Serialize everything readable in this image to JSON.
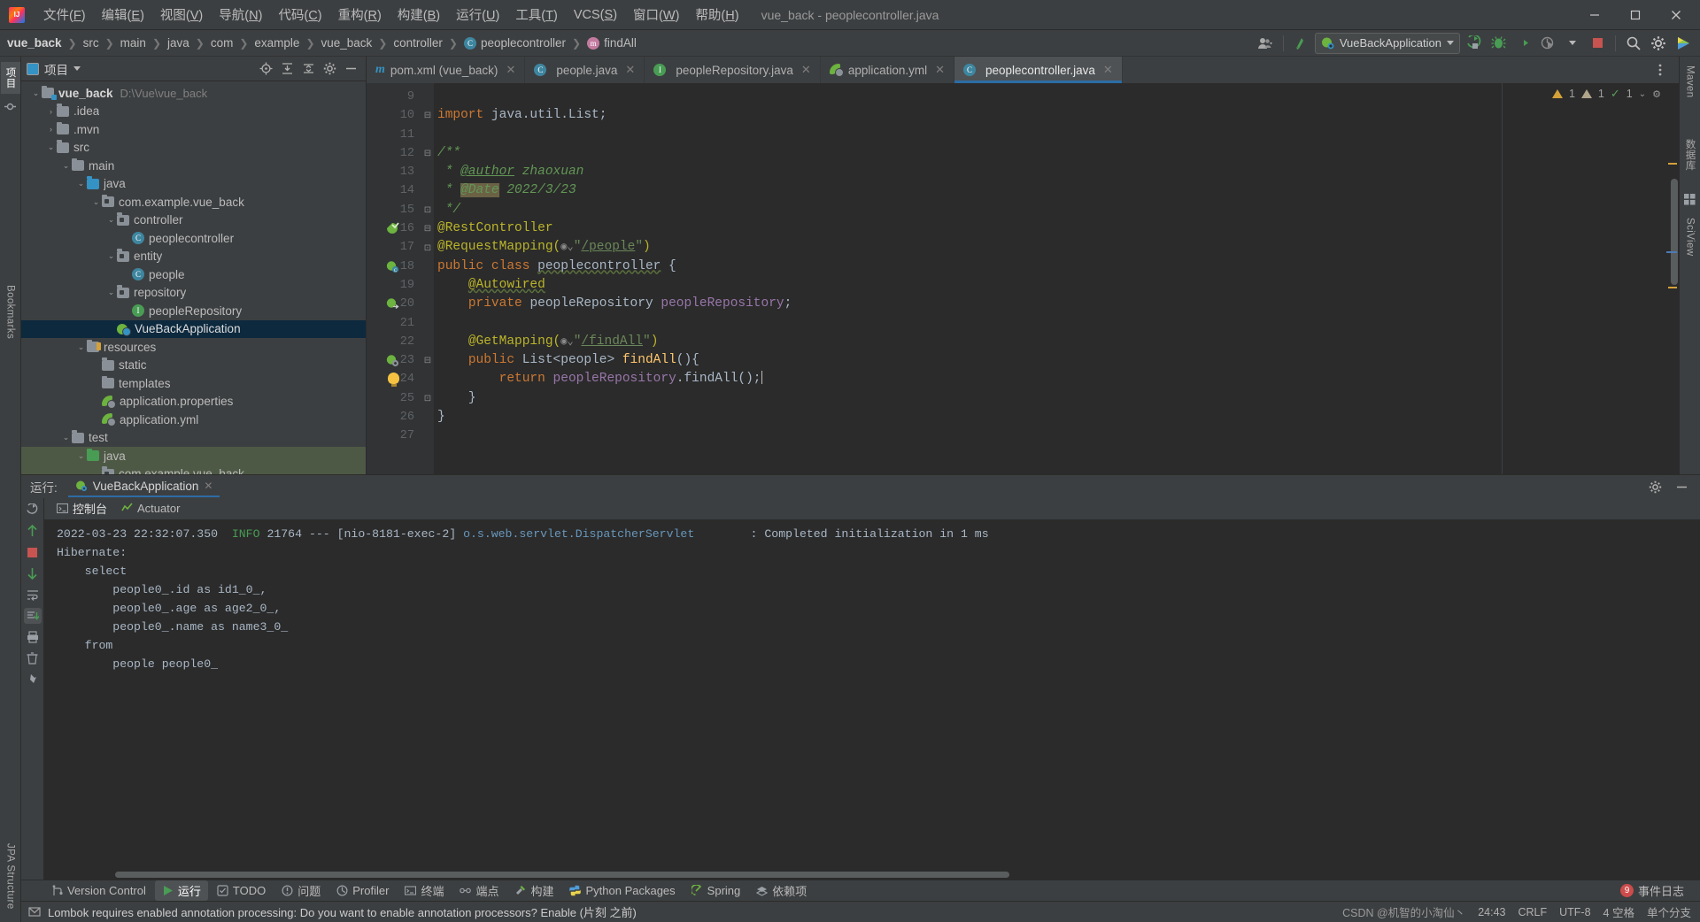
{
  "window": {
    "title": "vue_back - peoplecontroller.java",
    "minimize": "—",
    "maximize": "□",
    "close": "✕"
  },
  "menu": [
    {
      "label": "文件(F)",
      "name": "menu-file"
    },
    {
      "label": "编辑(E)",
      "name": "menu-edit"
    },
    {
      "label": "视图(V)",
      "name": "menu-view"
    },
    {
      "label": "导航(N)",
      "name": "menu-navigate"
    },
    {
      "label": "代码(C)",
      "name": "menu-code"
    },
    {
      "label": "重构(R)",
      "name": "menu-refactor"
    },
    {
      "label": "构建(B)",
      "name": "menu-build"
    },
    {
      "label": "运行(U)",
      "name": "menu-run"
    },
    {
      "label": "工具(T)",
      "name": "menu-tools"
    },
    {
      "label": "VCS(S)",
      "name": "menu-vcs"
    },
    {
      "label": "窗口(W)",
      "name": "menu-window"
    },
    {
      "label": "帮助(H)",
      "name": "menu-help"
    }
  ],
  "breadcrumb": {
    "items": [
      {
        "label": "vue_back",
        "icon": "",
        "bold": true
      },
      {
        "label": "src",
        "icon": ""
      },
      {
        "label": "main",
        "icon": ""
      },
      {
        "label": "java",
        "icon": ""
      },
      {
        "label": "com",
        "icon": ""
      },
      {
        "label": "example",
        "icon": ""
      },
      {
        "label": "vue_back",
        "icon": ""
      },
      {
        "label": "controller",
        "icon": ""
      },
      {
        "label": "peoplecontroller",
        "icon": "class-icon"
      },
      {
        "label": "findAll",
        "icon": "method-icon"
      }
    ]
  },
  "toolbar": {
    "run_config": "VueBackApplication",
    "run_tooltip": "运行",
    "debug_tooltip": "调试",
    "coverage_tooltip": "覆盖率运行",
    "profiler_tooltip": "性能分析",
    "stop_tooltip": "停止",
    "search_tooltip": "搜索",
    "settings_tooltip": "设置",
    "updates_tooltip": "更新"
  },
  "project_panel": {
    "title": "项目",
    "tree": [
      {
        "depth": 0,
        "arrow": "down",
        "icon": "folder-module",
        "label": "vue_back",
        "sub": "D:\\Vue\\vue_back",
        "bold": true,
        "state": "normal"
      },
      {
        "depth": 1,
        "arrow": "right",
        "icon": "folder",
        "label": ".idea",
        "sub": "",
        "state": "normal"
      },
      {
        "depth": 1,
        "arrow": "right",
        "icon": "folder",
        "label": ".mvn",
        "sub": "",
        "state": "normal"
      },
      {
        "depth": 1,
        "arrow": "down",
        "icon": "folder",
        "label": "src",
        "sub": "",
        "state": "normal"
      },
      {
        "depth": 2,
        "arrow": "down",
        "icon": "folder",
        "label": "main",
        "sub": "",
        "state": "normal"
      },
      {
        "depth": 3,
        "arrow": "down",
        "icon": "folder-source",
        "label": "java",
        "sub": "",
        "state": "normal"
      },
      {
        "depth": 4,
        "arrow": "down",
        "icon": "folder-package",
        "label": "com.example.vue_back",
        "sub": "",
        "state": "normal"
      },
      {
        "depth": 5,
        "arrow": "down",
        "icon": "folder-package",
        "label": "controller",
        "sub": "",
        "state": "normal"
      },
      {
        "depth": 6,
        "arrow": "none",
        "icon": "class-icon",
        "label": "peoplecontroller",
        "sub": "",
        "state": "normal"
      },
      {
        "depth": 5,
        "arrow": "down",
        "icon": "folder-package",
        "label": "entity",
        "sub": "",
        "state": "normal"
      },
      {
        "depth": 6,
        "arrow": "none",
        "icon": "class-icon",
        "label": "people",
        "sub": "",
        "state": "normal"
      },
      {
        "depth": 5,
        "arrow": "down",
        "icon": "folder-package",
        "label": "repository",
        "sub": "",
        "state": "normal"
      },
      {
        "depth": 6,
        "arrow": "none",
        "icon": "interface-icon",
        "label": "peopleRepository",
        "sub": "",
        "state": "normal"
      },
      {
        "depth": 5,
        "arrow": "none",
        "icon": "springboot-icon",
        "label": "VueBackApplication",
        "sub": "",
        "state": "selected"
      },
      {
        "depth": 3,
        "arrow": "down",
        "icon": "folder-resource",
        "label": "resources",
        "sub": "",
        "state": "normal"
      },
      {
        "depth": 4,
        "arrow": "none",
        "icon": "folder",
        "label": "static",
        "sub": "",
        "state": "normal"
      },
      {
        "depth": 4,
        "arrow": "none",
        "icon": "folder",
        "label": "templates",
        "sub": "",
        "state": "normal"
      },
      {
        "depth": 4,
        "arrow": "none",
        "icon": "spring-leaf-icon",
        "label": "application.properties",
        "sub": "",
        "state": "normal"
      },
      {
        "depth": 4,
        "arrow": "none",
        "icon": "spring-leaf-icon",
        "label": "application.yml",
        "sub": "",
        "state": "normal"
      },
      {
        "depth": 2,
        "arrow": "down",
        "icon": "folder",
        "label": "test",
        "sub": "",
        "state": "normal"
      },
      {
        "depth": 3,
        "arrow": "down",
        "icon": "folder-test",
        "label": "java",
        "sub": "",
        "state": "highlight"
      },
      {
        "depth": 4,
        "arrow": "down",
        "icon": "folder-package",
        "label": "com.example.vue_back",
        "sub": "",
        "state": "highlight"
      }
    ]
  },
  "editor": {
    "tabs": [
      {
        "label": "pom.xml (vue_back)",
        "icon": "maven-icon",
        "active": false
      },
      {
        "label": "people.java",
        "icon": "class-icon",
        "active": false
      },
      {
        "label": "peopleRepository.java",
        "icon": "interface-icon",
        "active": false
      },
      {
        "label": "application.yml",
        "icon": "spring-leaf-icon",
        "active": false
      },
      {
        "label": "peoplecontroller.java",
        "icon": "class-icon",
        "active": true
      }
    ],
    "inspection": {
      "warnings": "1",
      "weak_warnings": "1",
      "typos": "1"
    },
    "first_line_number": 9,
    "lines": [
      {
        "n": 9,
        "tokens": []
      },
      {
        "n": 10,
        "tokens": [
          {
            "t": "kw",
            "v": "import "
          },
          {
            "t": "id",
            "v": "java.util.List;"
          }
        ]
      },
      {
        "n": 11,
        "tokens": []
      },
      {
        "n": 12,
        "tokens": [
          {
            "t": "cmt",
            "v": "/**"
          }
        ]
      },
      {
        "n": 13,
        "tokens": [
          {
            "t": "cmt",
            "v": " * "
          },
          {
            "t": "cmt-tag",
            "v": "@author"
          },
          {
            "t": "cmt",
            "v": " zhaoxuan"
          }
        ]
      },
      {
        "n": 14,
        "tokens": [
          {
            "t": "cmt",
            "v": " * "
          },
          {
            "t": "cmt-hl",
            "v": "@Date"
          },
          {
            "t": "cmt",
            "v": " 2022/3/23"
          }
        ]
      },
      {
        "n": 15,
        "tokens": [
          {
            "t": "cmt",
            "v": " */"
          }
        ]
      },
      {
        "n": 16,
        "tokens": [
          {
            "t": "ann",
            "v": "@RestController"
          }
        ],
        "gmark": "bean"
      },
      {
        "n": 17,
        "tokens": [
          {
            "t": "ann",
            "v": "@RequestMapping("
          },
          {
            "t": "web",
            "v": ""
          },
          {
            "t": "str",
            "v": "\""
          },
          {
            "t": "url",
            "v": "/people"
          },
          {
            "t": "str",
            "v": "\""
          },
          {
            "t": "ann",
            "v": ")"
          }
        ]
      },
      {
        "n": 18,
        "tokens": [
          {
            "t": "kw",
            "v": "public class "
          },
          {
            "t": "warn",
            "v": "peoplecontroller"
          },
          {
            "t": "id",
            "v": " {"
          }
        ],
        "gmark": "bean-class"
      },
      {
        "n": 19,
        "tokens": [
          {
            "t": "sp",
            "v": "    "
          },
          {
            "t": "ann-warn",
            "v": "@Autowired"
          }
        ]
      },
      {
        "n": 20,
        "tokens": [
          {
            "t": "sp",
            "v": "    "
          },
          {
            "t": "kw",
            "v": "private "
          },
          {
            "t": "id",
            "v": "peopleRepository "
          },
          {
            "t": "fld",
            "v": "peopleRepository"
          },
          {
            "t": "id",
            "v": ";"
          }
        ],
        "gmark": "autowire"
      },
      {
        "n": 21,
        "tokens": []
      },
      {
        "n": 22,
        "tokens": [
          {
            "t": "sp",
            "v": "    "
          },
          {
            "t": "ann",
            "v": "@GetMapping("
          },
          {
            "t": "web",
            "v": ""
          },
          {
            "t": "str",
            "v": "\""
          },
          {
            "t": "url",
            "v": "/findAll"
          },
          {
            "t": "str",
            "v": "\""
          },
          {
            "t": "ann",
            "v": ")"
          }
        ]
      },
      {
        "n": 23,
        "tokens": [
          {
            "t": "sp",
            "v": "    "
          },
          {
            "t": "kw",
            "v": "public "
          },
          {
            "t": "id",
            "v": "List<people> "
          },
          {
            "t": "meth",
            "v": "findAll"
          },
          {
            "t": "id",
            "v": "(){"
          }
        ],
        "gmark": "mapping"
      },
      {
        "n": 24,
        "tokens": [
          {
            "t": "sp",
            "v": "        "
          },
          {
            "t": "kw",
            "v": "return "
          },
          {
            "t": "fld",
            "v": "peopleRepository"
          },
          {
            "t": "id",
            "v": ".findAll();"
          },
          {
            "t": "caret",
            "v": ""
          }
        ],
        "gmark": "bulb"
      },
      {
        "n": 25,
        "tokens": [
          {
            "t": "sp",
            "v": "    "
          },
          {
            "t": "id",
            "v": "}"
          }
        ]
      },
      {
        "n": 26,
        "tokens": [
          {
            "t": "id",
            "v": "}"
          }
        ]
      },
      {
        "n": 27,
        "tokens": []
      }
    ]
  },
  "run_panel": {
    "label": "运行:",
    "config_name": "VueBackApplication",
    "tabs": [
      {
        "label": "控制台",
        "icon": "console-icon",
        "active": true
      },
      {
        "label": "Actuator",
        "icon": "actuator-icon",
        "active": false
      }
    ],
    "console_lines": [
      {
        "type": "log",
        "ts": "2022-03-23 22:32:07.350",
        "level": "INFO",
        "pid": "21764",
        "dashes": "---",
        "thread": "[nio-8181-exec-2]",
        "logger": "o.s.web.servlet.DispatcherServlet",
        "pad": "        ",
        "msg": ": Completed initialization in 1 ms"
      },
      {
        "type": "plain",
        "text": "Hibernate: "
      },
      {
        "type": "plain",
        "text": "    select"
      },
      {
        "type": "plain",
        "text": "        people0_.id as id1_0_,"
      },
      {
        "type": "plain",
        "text": "        people0_.age as age2_0_,"
      },
      {
        "type": "plain",
        "text": "        people0_.name as name3_0_"
      },
      {
        "type": "plain",
        "text": "    from"
      },
      {
        "type": "plain",
        "text": "        people people0_"
      }
    ]
  },
  "bottom_toolwindows": [
    {
      "label": "Version Control",
      "icon": "vcs-icon",
      "active": false
    },
    {
      "label": "运行",
      "icon": "run-icon",
      "active": true
    },
    {
      "label": "TODO",
      "icon": "todo-icon",
      "active": false
    },
    {
      "label": "问题",
      "icon": "problems-icon",
      "active": false
    },
    {
      "label": "Profiler",
      "icon": "profiler-icon",
      "active": false
    },
    {
      "label": "终端",
      "icon": "terminal-icon",
      "active": false
    },
    {
      "label": "端点",
      "icon": "endpoints-icon",
      "active": false
    },
    {
      "label": "构建",
      "icon": "build-icon",
      "active": false
    },
    {
      "label": "Python Packages",
      "icon": "python-icon",
      "active": false
    },
    {
      "label": "Spring",
      "icon": "spring-icon",
      "active": false
    },
    {
      "label": "依赖项",
      "icon": "dependencies-icon",
      "active": false
    }
  ],
  "event_log": {
    "count": "9",
    "label": "事件日志"
  },
  "left_rail": [
    {
      "label": "项目",
      "name": "rail-tab-project",
      "selected": true
    },
    {
      "label": "提交",
      "name": "rail-tab-commit",
      "selected": false
    },
    {
      "label": "Bookmarks",
      "name": "rail-tab-bookmarks",
      "selected": false
    },
    {
      "label": "JPA Structure",
      "name": "rail-tab-jpa-structure",
      "selected": false
    }
  ],
  "right_rail": [
    {
      "label": "Maven",
      "name": "rail-tab-maven"
    },
    {
      "label": "数据库",
      "name": "rail-tab-database"
    },
    {
      "label": "SciView",
      "name": "rail-tab-sciview"
    }
  ],
  "statusbar": {
    "message": "Lombok requires enabled annotation processing: Do you want to enable annotation processors? Enable (片刻 之前)",
    "position": "24:43",
    "line_sep": "CRLF",
    "encoding": "UTF-8",
    "indent": "4 空格",
    "branch": "单个分支",
    "watermark": "CSDN @机智的小淘仙丶"
  },
  "colors": {
    "accent": "#2d6ca5",
    "selection": "#0d293e",
    "test_highlight": "#4e5945",
    "editor_bg": "#2b2b2b",
    "panel_bg": "#3c3f41",
    "warning": "#d4a139",
    "keyword": "#cc7832",
    "string": "#6a8759",
    "annotation": "#bbb529",
    "comment": "#629755",
    "field": "#9876aa",
    "method": "#ffc66d"
  }
}
